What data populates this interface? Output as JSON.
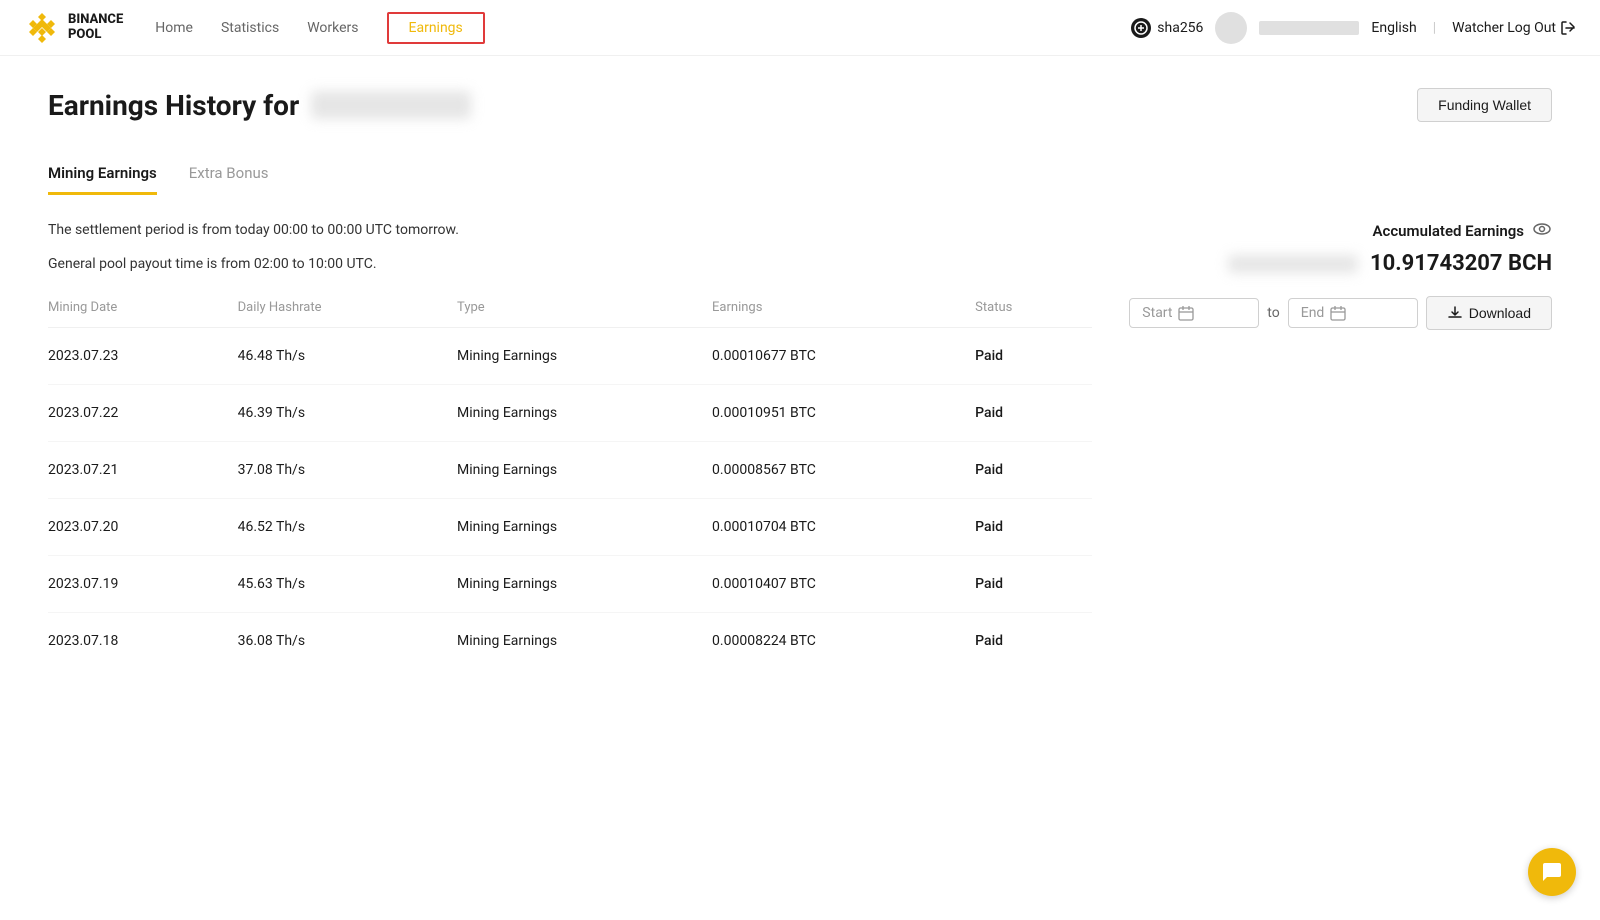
{
  "header": {
    "logo_line1": "BINANCE",
    "logo_line2": "POOL",
    "nav_items": [
      {
        "label": "Home",
        "active": false
      },
      {
        "label": "Statistics",
        "active": false
      },
      {
        "label": "Workers",
        "active": false
      },
      {
        "label": "Earnings",
        "active": true
      }
    ],
    "hash_algo": "sha256",
    "language": "English",
    "watcher_logout": "Watcher Log Out"
  },
  "page": {
    "title": "Earnings History for",
    "funding_wallet_btn": "Funding Wallet"
  },
  "tabs": [
    {
      "label": "Mining Earnings",
      "active": true
    },
    {
      "label": "Extra Bonus",
      "active": false
    }
  ],
  "right_panel": {
    "accumulated_label": "Accumulated Earnings",
    "accumulated_amount": "10.91743207 BCH"
  },
  "info": {
    "settlement_text": "The settlement period is from today 00:00 to 00:00 UTC tomorrow.",
    "payout_text": "General pool payout time is from 02:00 to 10:00 UTC."
  },
  "date_filter": {
    "start_placeholder": "Start",
    "to_label": "to",
    "end_placeholder": "End",
    "download_label": "Download"
  },
  "table": {
    "columns": [
      {
        "label": "Mining Date"
      },
      {
        "label": "Daily Hashrate"
      },
      {
        "label": "Type"
      },
      {
        "label": "Earnings"
      },
      {
        "label": "Status"
      }
    ],
    "rows": [
      {
        "date": "2023.07.23",
        "hashrate": "46.48 Th/s",
        "type": "Mining Earnings",
        "earnings": "0.00010677 BTC",
        "status": "Paid"
      },
      {
        "date": "2023.07.22",
        "hashrate": "46.39 Th/s",
        "type": "Mining Earnings",
        "earnings": "0.00010951 BTC",
        "status": "Paid"
      },
      {
        "date": "2023.07.21",
        "hashrate": "37.08 Th/s",
        "type": "Mining Earnings",
        "earnings": "0.00008567 BTC",
        "status": "Paid"
      },
      {
        "date": "2023.07.20",
        "hashrate": "46.52 Th/s",
        "type": "Mining Earnings",
        "earnings": "0.00010704 BTC",
        "status": "Paid"
      },
      {
        "date": "2023.07.19",
        "hashrate": "45.63 Th/s",
        "type": "Mining Earnings",
        "earnings": "0.00010407 BTC",
        "status": "Paid"
      },
      {
        "date": "2023.07.18",
        "hashrate": "36.08 Th/s",
        "type": "Mining Earnings",
        "earnings": "0.00008224 BTC",
        "status": "Paid"
      }
    ]
  },
  "colors": {
    "accent": "#f0b90b",
    "paid": "#02c076",
    "active_nav_border": "#e03a3a"
  }
}
